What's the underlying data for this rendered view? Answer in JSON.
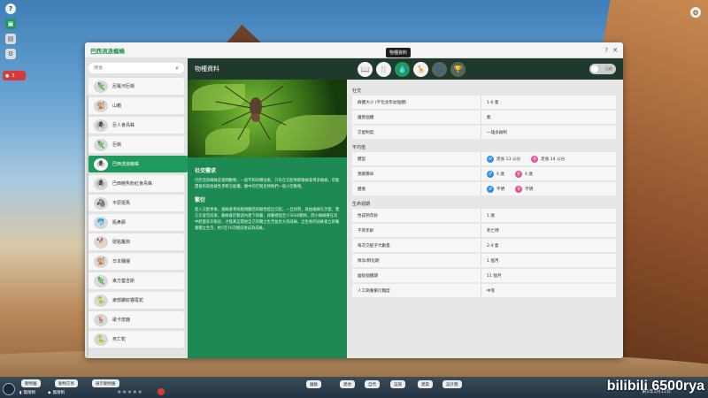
{
  "window": {
    "title": "巴西流浪蜘蛛"
  },
  "tooltip": "物種資料",
  "sidebar": {
    "search_placeholder": "搜尋",
    "items": [
      {
        "label": "尼羅河巨蜥",
        "icon": "lizard-icon",
        "glyph": "🦎"
      },
      {
        "label": "山魈",
        "icon": "mandrill-icon",
        "glyph": "🐒"
      },
      {
        "label": "巨人食鳥蛛",
        "icon": "spider-icon",
        "glyph": "🕷"
      },
      {
        "label": "巨蜥",
        "icon": "lizard-icon",
        "glyph": "🦎"
      },
      {
        "label": "巴西流浪蜘蛛",
        "icon": "spider-icon",
        "glyph": "🕷"
      },
      {
        "label": "巴西鮭魚粉紅食鳥蛛",
        "icon": "spider-icon",
        "glyph": "🕷"
      },
      {
        "label": "平原斑馬",
        "icon": "zebra-icon",
        "glyph": "🦓"
      },
      {
        "label": "瓶鼻豚",
        "icon": "dolphin-icon",
        "glyph": "🐬"
      },
      {
        "label": "斑點鬣狗",
        "icon": "hyena-icon",
        "glyph": "🐕"
      },
      {
        "label": "日本獼猴",
        "icon": "macaque-icon",
        "glyph": "🐒"
      },
      {
        "label": "東方蓋吉斯",
        "icon": "gecko-icon",
        "glyph": "🦎"
      },
      {
        "label": "東部鑽紋響尾蛇",
        "icon": "snake-icon",
        "glyph": "🐍"
      },
      {
        "label": "歌卡皮鹿",
        "icon": "okapi-icon",
        "glyph": "🦌"
      },
      {
        "label": "死亡蛇",
        "icon": "snake-icon",
        "glyph": "🐍"
      }
    ],
    "active_index": 4
  },
  "center": {
    "section_title": "物種資料",
    "social_heading": "社交需求",
    "social_text": "巴西流浪蜘蛛是夜間動物，一般不和同類往來，只有在交配季節雄蛛會尋求雌蛛，可能還會和其他雄性爭奪交配權。繳中的空間足夠牠們一般小型動物。",
    "breeding_heading": "繁衍",
    "breeding_text": "進入交配季後，雄蛛會尋找能夠聽話的雌性提出交配。一旦找到，就由雄蛛先示愛，雙方交會完成後，雌蛛會於數週內產下卵囊，卵囊裡面至少3000顆卵，而小蜘蛛要在其中經歷多次蛻皮，才能真正開始自己的獨立生活並長大為成蛛。出生後的幼蛛會立即離巢獨立生活，約5至10次蛻皮後成為成蛛。"
  },
  "right": {
    "tabs": [
      {
        "icon": "info-icon",
        "glyph": "📖"
      },
      {
        "icon": "shelter-icon",
        "glyph": "🍴"
      },
      {
        "icon": "species-icon",
        "glyph": "💧"
      },
      {
        "icon": "habitat-icon",
        "glyph": "🦒"
      },
      {
        "icon": "paw-icon",
        "glyph": "🐾"
      },
      {
        "icon": "award-icon",
        "glyph": "🏆"
      }
    ],
    "active_tab": 2,
    "toggle_label": "比較",
    "social": {
      "heading": "社交",
      "rows": [
        {
          "k": "群體大小 (不包含年幼個體)",
          "v": "1-6 隻"
        },
        {
          "k": "優勢個體",
          "v": "無"
        },
        {
          "k": "交配制度",
          "v": "一雄多雌制"
        }
      ]
    },
    "average": {
      "heading": "平均值",
      "rows": [
        {
          "k": "體型",
          "male": "足長 13 公分",
          "female": "足長 14 公分"
        },
        {
          "k": "預期壽命",
          "male": "4 歲",
          "female": "4 歲"
        },
        {
          "k": "體重",
          "male": "不明",
          "female": "不明"
        }
      ]
    },
    "life": {
      "heading": "生命週期",
      "rows": [
        {
          "k": "性成熟年齡",
          "v": "1 歲"
        },
        {
          "k": "不育年齡",
          "v": "死亡時"
        },
        {
          "k": "每次交配子代數量",
          "v": "2-4 隻"
        },
        {
          "k": "懷孕/孵化期",
          "v": "1 個月"
        },
        {
          "k": "幽殼個體期",
          "v": "11 個月"
        },
        {
          "k": "人工飼養繁衍難度",
          "v": "中等"
        }
      ]
    }
  },
  "bottom": {
    "pills_left": [
      "動物園",
      "動物交易",
      "展示動物園"
    ],
    "money": "無限制",
    "money2": "無限制",
    "stars": "★★★★★",
    "pills_center": [
      "園藝",
      "建地",
      "自然",
      "設施",
      "建築",
      "設計圖"
    ],
    "date": "第1年1月11日",
    "watermark": "bilibili 6500rya"
  },
  "colors": {
    "accent": "#1f9a5c",
    "dark": "#20392d",
    "male": "#2f8fdd",
    "female": "#e0569b"
  }
}
